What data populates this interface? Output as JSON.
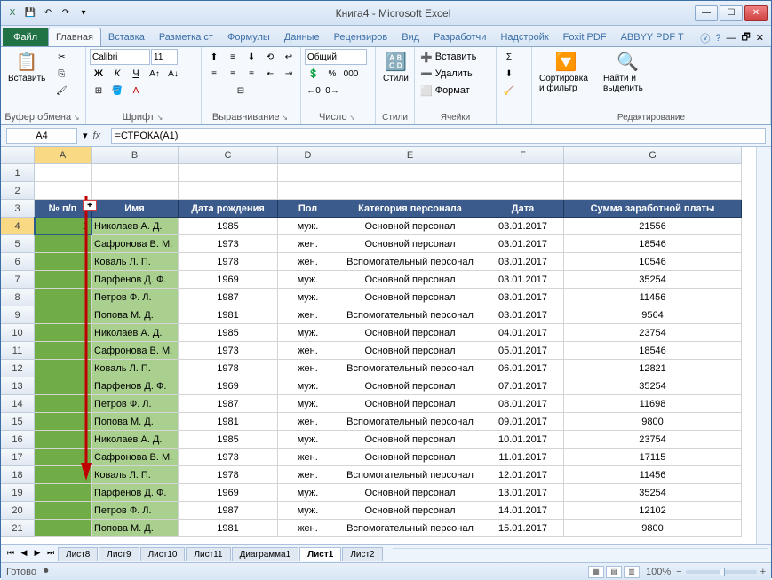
{
  "title": "Книга4 - Microsoft Excel",
  "qat": {
    "excel": "X",
    "save": "💾",
    "undo": "↶",
    "redo": "↷"
  },
  "tabs": {
    "file": "Файл",
    "home": "Главная",
    "insert": "Вставка",
    "layout": "Разметка ст",
    "formulas": "Формулы",
    "data": "Данные",
    "review": "Рецензиров",
    "view": "Вид",
    "developer": "Разработчи",
    "addins": "Надстройк",
    "foxit": "Foxit PDF",
    "abbyy": "ABBYY PDF T"
  },
  "ribbon": {
    "clipboard": {
      "label": "Буфер обмена",
      "paste": "Вставить"
    },
    "font": {
      "label": "Шрифт",
      "name": "Calibri",
      "size": "11"
    },
    "alignment": {
      "label": "Выравнивание"
    },
    "number": {
      "label": "Число",
      "format": "Общий"
    },
    "styles": {
      "label": "Стили",
      "btn": "Стили"
    },
    "cells": {
      "label": "Ячейки",
      "insert": "Вставить",
      "delete": "Удалить",
      "format": "Формат"
    },
    "editing": {
      "label": "Редактирование",
      "sort": "Сортировка и фильтр",
      "find": "Найти и выделить"
    }
  },
  "namebox": "A4",
  "formula": "=СТРОКА(A1)",
  "columns": [
    "A",
    "B",
    "C",
    "D",
    "E",
    "F",
    "G"
  ],
  "rownums": [
    "1",
    "2",
    "3",
    "4",
    "5",
    "6",
    "7",
    "8",
    "9",
    "10",
    "11",
    "12",
    "13",
    "14",
    "15",
    "16",
    "17",
    "18",
    "19",
    "20",
    "21"
  ],
  "headers": {
    "a": "№ п/п",
    "b": "Имя",
    "c": "Дата рождения",
    "d": "Пол",
    "e": "Категория персонала",
    "f": "Дата",
    "g": "Сумма заработной платы"
  },
  "rows": [
    {
      "a": "1",
      "b": "Николаев А. Д.",
      "c": "1985",
      "d": "муж.",
      "e": "Основной персонал",
      "f": "03.01.2017",
      "g": "21556"
    },
    {
      "a": "",
      "b": "Сафронова В. М.",
      "c": "1973",
      "d": "жен.",
      "e": "Основной персонал",
      "f": "03.01.2017",
      "g": "18546"
    },
    {
      "a": "",
      "b": "Коваль Л. П.",
      "c": "1978",
      "d": "жен.",
      "e": "Вспомогательный персонал",
      "f": "03.01.2017",
      "g": "10546"
    },
    {
      "a": "",
      "b": "Парфенов Д. Ф.",
      "c": "1969",
      "d": "муж.",
      "e": "Основной персонал",
      "f": "03.01.2017",
      "g": "35254"
    },
    {
      "a": "",
      "b": "Петров Ф. Л.",
      "c": "1987",
      "d": "муж.",
      "e": "Основной персонал",
      "f": "03.01.2017",
      "g": "11456"
    },
    {
      "a": "",
      "b": "Попова М. Д.",
      "c": "1981",
      "d": "жен.",
      "e": "Вспомогательный персонал",
      "f": "03.01.2017",
      "g": "9564"
    },
    {
      "a": "",
      "b": "Николаев А. Д.",
      "c": "1985",
      "d": "муж.",
      "e": "Основной персонал",
      "f": "04.01.2017",
      "g": "23754"
    },
    {
      "a": "",
      "b": "Сафронова В. М.",
      "c": "1973",
      "d": "жен.",
      "e": "Основной персонал",
      "f": "05.01.2017",
      "g": "18546"
    },
    {
      "a": "",
      "b": "Коваль Л. П.",
      "c": "1978",
      "d": "жен.",
      "e": "Вспомогательный персонал",
      "f": "06.01.2017",
      "g": "12821"
    },
    {
      "a": "",
      "b": "Парфенов Д. Ф.",
      "c": "1969",
      "d": "муж.",
      "e": "Основной персонал",
      "f": "07.01.2017",
      "g": "35254"
    },
    {
      "a": "",
      "b": "Петров Ф. Л.",
      "c": "1987",
      "d": "муж.",
      "e": "Основной персонал",
      "f": "08.01.2017",
      "g": "11698"
    },
    {
      "a": "",
      "b": "Попова М. Д.",
      "c": "1981",
      "d": "жен.",
      "e": "Вспомогательный персонал",
      "f": "09.01.2017",
      "g": "9800"
    },
    {
      "a": "",
      "b": "Николаев А. Д.",
      "c": "1985",
      "d": "муж.",
      "e": "Основной персонал",
      "f": "10.01.2017",
      "g": "23754"
    },
    {
      "a": "",
      "b": "Сафронова В. М.",
      "c": "1973",
      "d": "жен.",
      "e": "Основной персонал",
      "f": "11.01.2017",
      "g": "17115"
    },
    {
      "a": "",
      "b": "Коваль Л. П.",
      "c": "1978",
      "d": "жен.",
      "e": "Вспомогательный персонал",
      "f": "12.01.2017",
      "g": "11456"
    },
    {
      "a": "",
      "b": "Парфенов Д. Ф.",
      "c": "1969",
      "d": "муж.",
      "e": "Основной персонал",
      "f": "13.01.2017",
      "g": "35254"
    },
    {
      "a": "",
      "b": "Петров Ф. Л.",
      "c": "1987",
      "d": "муж.",
      "e": "Основной персонал",
      "f": "14.01.2017",
      "g": "12102"
    },
    {
      "a": "",
      "b": "Попова М. Д.",
      "c": "1981",
      "d": "жен.",
      "e": "Вспомогательный персонал",
      "f": "15.01.2017",
      "g": "9800"
    }
  ],
  "sheets": {
    "l8": "Лист8",
    "l9": "Лист9",
    "l10": "Лист10",
    "l11": "Лист11",
    "diag": "Диаграмма1",
    "l1": "Лист1",
    "l2": "Лист2"
  },
  "status": {
    "ready": "Готово",
    "zoom": "100%"
  }
}
